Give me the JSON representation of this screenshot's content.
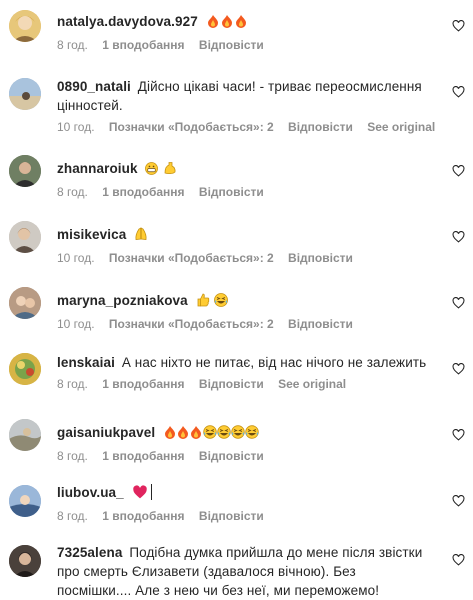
{
  "comments": [
    {
      "username": "natalya.davydova.927",
      "text": "",
      "emojis": [
        "fire",
        "fire",
        "fire"
      ],
      "time": "8 год.",
      "likes": "1 вподобання",
      "reply": "Відповісти",
      "see_original": "",
      "avatar_color": "#e0b85c"
    },
    {
      "username": "0890_natali",
      "text": "Дійсно цікаві часи! - триває переосмислення цінностей.",
      "emojis": [],
      "time": "10 год.",
      "likes": "Позначки «Подобається»: 2",
      "reply": "Відповісти",
      "see_original": "See original",
      "avatar_color": "#8aa6c1"
    },
    {
      "username": "zhannaroiuk",
      "text": "",
      "emojis": [
        "grin",
        "muscle"
      ],
      "time": "8 год.",
      "likes": "1 вподобання",
      "reply": "Відповісти",
      "see_original": "",
      "avatar_color": "#5d6b52"
    },
    {
      "username": "misikevica",
      "text": "",
      "emojis": [
        "hands"
      ],
      "time": "10 год.",
      "likes": "Позначки «Подобається»: 2",
      "reply": "Відповісти",
      "see_original": "",
      "avatar_color": "#b9b4ae"
    },
    {
      "username": "maryna_pozniakova",
      "text": "",
      "emojis": [
        "thumb",
        "laugh"
      ],
      "time": "10 год.",
      "likes": "Позначки «Подобається»: 2",
      "reply": "Відповісти",
      "see_original": "",
      "avatar_color": "#9a7a64"
    },
    {
      "username": "lenskaiai",
      "text": "А нас ніхто не питає, від нас нічого не залежить",
      "emojis": [],
      "time": "8 год.",
      "likes": "1 вподобання",
      "reply": "Відповісти",
      "see_original": "See original",
      "avatar_color": "#c8a032"
    },
    {
      "username": "gaisaniukpavel",
      "text": "",
      "emojis": [
        "fire",
        "fire",
        "fire",
        "laugh",
        "laugh",
        "laugh",
        "laugh"
      ],
      "time": "8 год.",
      "likes": "1 вподобання",
      "reply": "Відповісти",
      "see_original": "",
      "avatar_color": "#a6a89e"
    },
    {
      "username": "liubov.ua_",
      "text": "",
      "emojis": [
        "redheart"
      ],
      "time": "8 год.",
      "likes": "1 вподобання",
      "reply": "Відповісти",
      "see_original": "",
      "avatar_color": "#7d9cc4"
    },
    {
      "username": "7325alena",
      "text": "Подібна думка прийшла до мене після звістки про смерть Єлизавети (здавалося вічною). Без посмішки.... Але з нею чи без неї, ми переможемо!",
      "emojis": [],
      "time": "",
      "likes": "",
      "reply": "",
      "see_original": "",
      "avatar_color": "#3a3330"
    }
  ]
}
